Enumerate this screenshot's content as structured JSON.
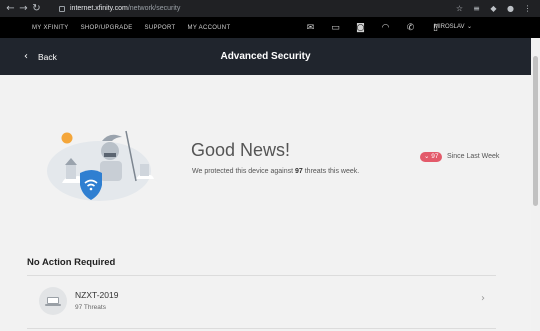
{
  "browser": {
    "url_host": "internet.xfinity.com",
    "url_path": "/network/security",
    "back_icon": "←",
    "forward_icon": "→",
    "reload_icon": "↻",
    "ext_icons": [
      "star-icon",
      "playlist-icon",
      "extension-icon",
      "profile-icon",
      "menu-icon"
    ]
  },
  "site_nav": {
    "links": [
      "MY XFINITY",
      "SHOP/UPGRADE",
      "SUPPORT",
      "MY ACCOUNT"
    ],
    "icons": [
      "mail-icon",
      "tv-icon",
      "camera-icon",
      "wifi-icon",
      "phone-icon",
      "mobile-icon"
    ],
    "user_name": "MIROSLAV",
    "user_chevron": "⌄"
  },
  "header": {
    "back_label": "Back",
    "back_chevron": "‹",
    "title": "Advanced Security"
  },
  "summary": {
    "headline": "Good News!",
    "protect_prefix": "We protected this device against ",
    "threat_count": "97",
    "protect_suffix": " threats this week.",
    "badge_text": "⌄ 97",
    "since_text": "Since Last Week"
  },
  "devices": {
    "section_title": "No Action Required",
    "items": [
      {
        "name": "NZXT-2019",
        "threats": "97 Threats",
        "chevron": "›"
      }
    ]
  },
  "colors": {
    "header_bg": "#20252d",
    "nav_bg": "#000000",
    "badge": "#e35a6a",
    "shield": "#2f7fd1"
  }
}
